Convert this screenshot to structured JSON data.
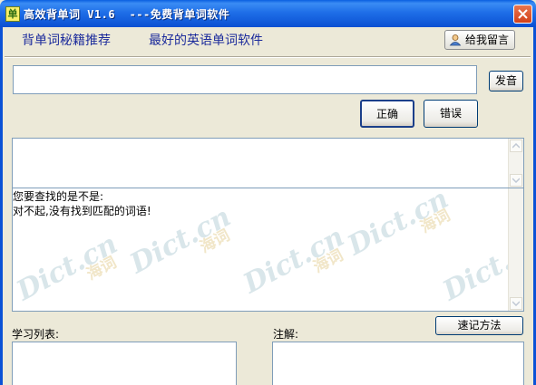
{
  "window": {
    "icon_glyph": "单",
    "title": "高效背单词 V1.6  ---免费背单词软件"
  },
  "links": {
    "tips": "背单词秘籍推荐",
    "best": "最好的英语单词软件"
  },
  "message_button": "给我留言",
  "word_input": {
    "value": "",
    "placeholder": ""
  },
  "buttons": {
    "pronounce": "发音",
    "correct": "正确",
    "wrong": "错误",
    "memory_method": "速记方法"
  },
  "result": {
    "line1": "您要查找的是不是:",
    "line2": "对不起,没有找到匹配的词语!"
  },
  "watermark": {
    "text": "Dict.cn",
    "cn": "海词"
  },
  "labels": {
    "study_list": "学习列表:",
    "notes": "注解:"
  },
  "colors": {
    "title_bar": "#0a5fe0",
    "link": "#1d2c9c",
    "close": "#d2411a"
  },
  "icons": [
    "app-icon",
    "close-icon",
    "user-icon",
    "scroll-up-icon",
    "scroll-down-icon"
  ]
}
